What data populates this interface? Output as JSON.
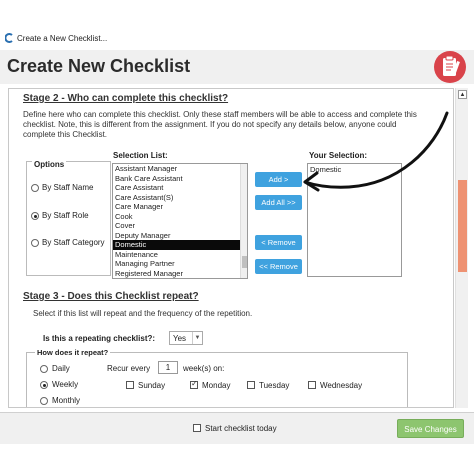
{
  "window": {
    "title": "Create a New Checklist..."
  },
  "header": {
    "title": "Create New Checklist"
  },
  "stage2": {
    "title": "Stage 2 - Who can complete this checklist?",
    "desc_line1": "Define here who can complete this checklist.  Only these staff members will be able to access and complete this",
    "desc_line2": "checklist.  Note, this is different from the assignment.  If you do not specify any details below, anyone could",
    "desc_line3": "complete this Checklist.",
    "options": {
      "label": "Options",
      "by_staff_name": "By Staff Name",
      "by_staff_role": "By Staff Role",
      "by_staff_category": "By Staff Category",
      "selected": "By Staff Role"
    },
    "selection_list": {
      "label": "Selection List:",
      "items": [
        "Assistant Manager",
        "Bank Care Assistant",
        "Care Assistant",
        "Care Assistant(S)",
        "Care Manager",
        "Cook",
        "Cover",
        "Deputy Manager",
        "Domestic",
        "Maintenance",
        "Managing Partner",
        "Registered Manager"
      ],
      "selected": "Domestic"
    },
    "buttons": {
      "add": "Add >",
      "add_all": "Add All >>",
      "remove": "< Remove",
      "remove_all": "<< Remove All"
    },
    "your_selection": {
      "label": "Your Selection:",
      "items": [
        "Domestic"
      ]
    }
  },
  "stage3": {
    "title": "Stage 3 - Does this Checklist repeat?",
    "desc": "Select if this list will repeat and the frequency of the repetition.",
    "repeating_label": "Is this a repeating checklist?:",
    "repeating_value": "Yes",
    "how_repeat_label": "How does it repeat?",
    "daily": "Daily",
    "weekly": "Weekly",
    "monthly": "Monthly",
    "recur_every": "Recur every",
    "recur_value": "1",
    "weeks_on": "week(s) on:",
    "days": {
      "sunday": "Sunday",
      "monday": "Monday",
      "tuesday": "Tuesday",
      "wednesday": "Wednesday"
    }
  },
  "footer": {
    "start_today": "Start checklist today",
    "save": "Save Changes"
  },
  "colors": {
    "accent_blue": "#3fa2df",
    "save_green": "#8dc56f",
    "scroll_thumb": "#ee9273",
    "icon_red": "#d9434a"
  }
}
